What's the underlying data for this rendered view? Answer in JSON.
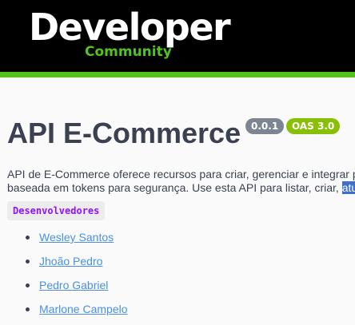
{
  "header": {
    "logo_main": "Developer",
    "logo_sub": "Community",
    "accent_color": "#52c41a"
  },
  "info": {
    "title": "API E-Commerce",
    "version_badge": "0.0.1",
    "oas_badge": "OAS 3.0",
    "description_line1": "API de E-Commerce oferece recursos para criar, gerenciar e integrar p",
    "description_line2_prefix": "baseada em tokens para segurança. Use esta API para listar, criar, ",
    "description_line2_selected": "atu"
  },
  "contact": {
    "label": "Desenvolvedores",
    "developers": [
      {
        "name": "Wesley Santos"
      },
      {
        "name": "Jhoão Pedro"
      },
      {
        "name": "Pedro Gabriel"
      },
      {
        "name": "Marlone Campelo"
      }
    ]
  }
}
